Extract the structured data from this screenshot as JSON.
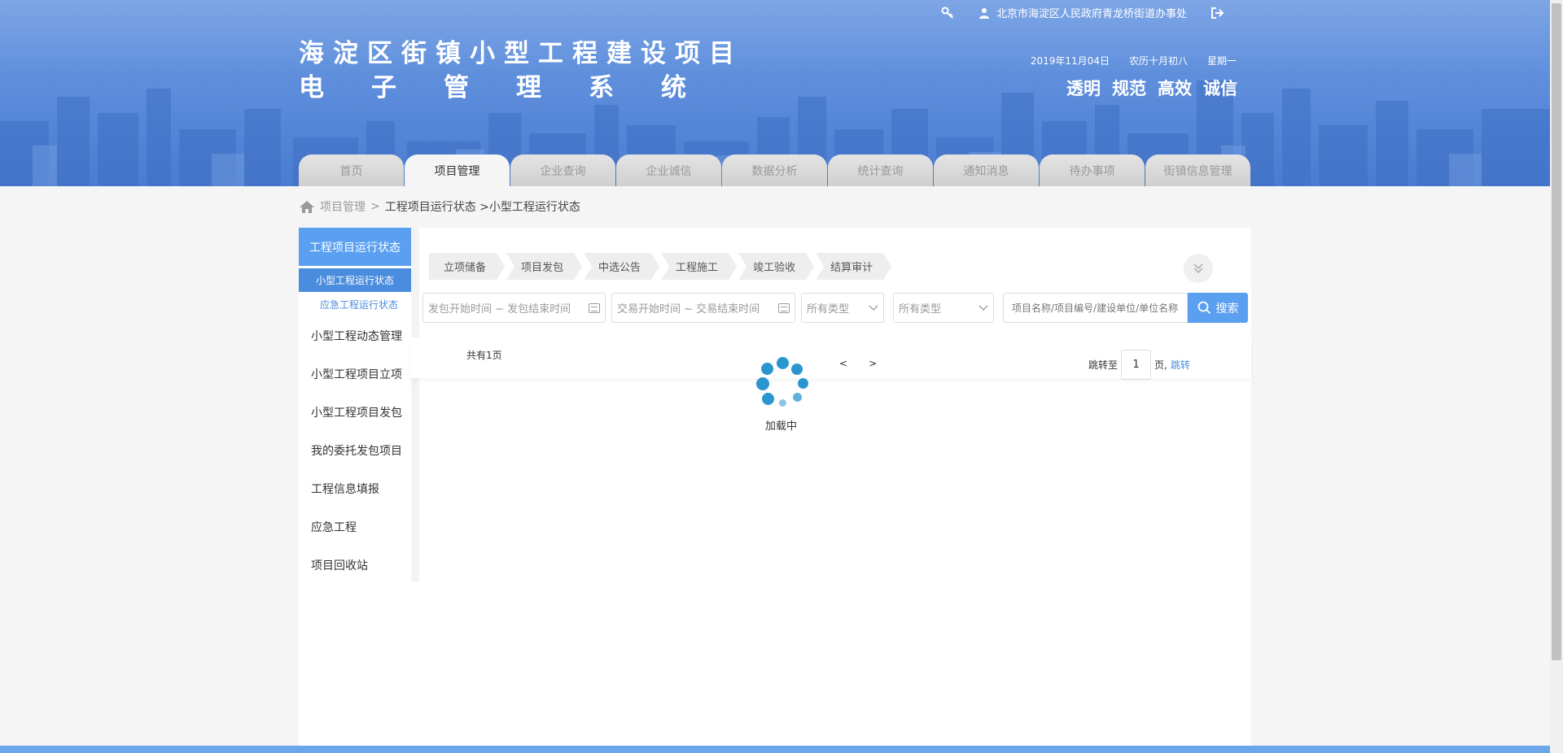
{
  "header": {
    "title_line1": "海淀区街镇小型工程建设项目",
    "title_line2": "电子管理系统",
    "user": "北京市海淀区人民政府青龙桥街道办事处",
    "date": "2019年11月04日",
    "lunar": "农历十月初八",
    "weekday": "星期一",
    "motto": [
      "透明",
      "规范",
      "高效",
      "诚信"
    ]
  },
  "nav": {
    "tabs": [
      "首页",
      "项目管理",
      "企业查询",
      "企业诚信",
      "数据分析",
      "统计查询",
      "通知消息",
      "待办事项",
      "街镇信息管理"
    ],
    "active_index": 1
  },
  "breadcrumb": {
    "root": "项目管理",
    "sep": ">",
    "current": "工程项目运行状态 >小型工程运行状态"
  },
  "sidebar": {
    "head": "工程项目运行状态",
    "sub_active": "小型工程运行状态",
    "sub_other": "应急工程运行状态",
    "items": [
      "小型工程动态管理",
      "小型工程项目立项",
      "小型工程项目发包",
      "我的委托发包项目",
      "工程信息填报",
      "应急工程",
      "项目回收站"
    ]
  },
  "steps": [
    "立项储备",
    "项目发包",
    "中选公告",
    "工程施工",
    "竣工验收",
    "结算审计"
  ],
  "filters": {
    "date1_placeholder": "发包开始时间 ~ 发包结束时间",
    "date2_placeholder": "交易开始时间 ~ 交易结束时间",
    "type1": "所有类型",
    "type2": "所有类型",
    "search_placeholder": "项目名称/项目编号/建设单位/单位名称",
    "search_label": "搜索"
  },
  "pager": {
    "total": "共有1页",
    "prev": "<",
    "next": ">",
    "jump_prefix": "跳转至",
    "page_value": "1",
    "jump_suffix": "页,",
    "jump_btn": "跳转"
  },
  "loading_text": "加载中",
  "colors": {
    "primary": "#5b9ff0",
    "primary_dark": "#4a8cde",
    "header_blue": "#5f8fdc",
    "loader_dot": "#2a96d0"
  }
}
